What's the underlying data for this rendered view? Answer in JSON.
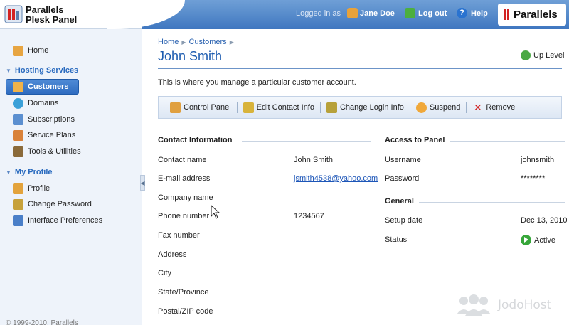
{
  "header": {
    "app_title_line1": "Parallels",
    "app_title_line2": "Plesk Panel",
    "logged_in_label": "Logged in as",
    "user_name": "Jane Doe",
    "logout_label": "Log out",
    "help_label": "Help",
    "brand_text": "Parallels"
  },
  "sidebar": {
    "home": "Home",
    "group_hosting": "Hosting Services",
    "items_hosting": [
      "Customers",
      "Domains",
      "Subscriptions",
      "Service Plans",
      "Tools & Utilities"
    ],
    "group_profile": "My Profile",
    "items_profile": [
      "Profile",
      "Change Password",
      "Interface Preferences"
    ],
    "copyright": "© 1999-2010, Parallels"
  },
  "main": {
    "breadcrumb": [
      "Home",
      "Customers"
    ],
    "title": "John Smith",
    "up_level": "Up Level",
    "description": "This is where you manage a particular customer account.",
    "toolbar": [
      "Control Panel",
      "Edit Contact Info",
      "Change Login Info",
      "Suspend",
      "Remove"
    ],
    "contact": {
      "title": "Contact Information",
      "labels": [
        "Contact name",
        "E-mail address",
        "Company name",
        "Phone number",
        "Fax number",
        "Address",
        "City",
        "State/Province",
        "Postal/ZIP code"
      ],
      "contact_name": "John Smith",
      "email": "jsmith4538@yahoo.com",
      "phone": "1234567"
    },
    "access": {
      "title": "Access to Panel",
      "username_label": "Username",
      "username": "johnsmith",
      "password_label": "Password",
      "password": "********"
    },
    "general": {
      "title": "General",
      "setup_label": "Setup date",
      "setup_date": "Dec 13, 2010",
      "status_label": "Status",
      "status": "Active"
    }
  },
  "watermark": "JodoHost",
  "colors": {
    "accent": "#1d5cb0",
    "header": "#3f77c0",
    "active_nav": "#2f6cc0",
    "status_active": "#37a63a"
  }
}
